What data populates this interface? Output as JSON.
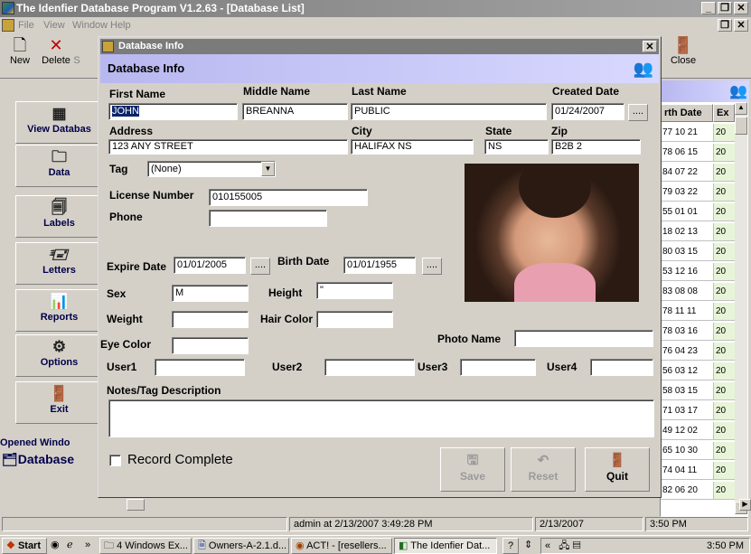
{
  "app": {
    "title": "The Idenfier Database Program V1.2.63 - [Database List]",
    "menu": [
      "File",
      "View",
      "Window",
      "Help"
    ],
    "toolbar": {
      "new": "New",
      "delete": "Delete",
      "s_label": "S",
      "close": "Close"
    },
    "sidebar": [
      {
        "label": "View Databas",
        "icon": "grid-icon"
      },
      {
        "label": "Data",
        "icon": "folder-icon"
      },
      {
        "label": "Labels",
        "icon": "labels-icon"
      },
      {
        "label": "Letters",
        "icon": "letters-icon"
      },
      {
        "label": "Reports",
        "icon": "reports-icon"
      },
      {
        "label": "Options",
        "icon": "options-icon"
      },
      {
        "label": "Exit",
        "icon": "exit-icon"
      }
    ],
    "opened_window_label": "Opened Windo",
    "opened_item": "Database",
    "grid": {
      "headers": [
        "rth Date",
        "Ex"
      ],
      "rows": [
        [
          "77 10 21",
          "20"
        ],
        [
          "78 06 15",
          "20"
        ],
        [
          "84 07 22",
          "20"
        ],
        [
          "79 03 22",
          "20"
        ],
        [
          "55 01 01",
          "20"
        ],
        [
          "18 02 13",
          "20"
        ],
        [
          "80 03 15",
          "20"
        ],
        [
          "53 12 16",
          "20"
        ],
        [
          "83 08 08",
          "20"
        ],
        [
          "78 11 11",
          "20"
        ],
        [
          "78 03 16",
          "20"
        ],
        [
          "76 04 23",
          "20"
        ],
        [
          "56 03 12",
          "20"
        ],
        [
          "58 03 15",
          "20"
        ],
        [
          "71 03 17",
          "20"
        ],
        [
          "49 12 02",
          "20"
        ],
        [
          "65 10 30",
          "20"
        ],
        [
          "74 04 11",
          "20"
        ],
        [
          "82 06 20",
          "20"
        ]
      ]
    },
    "status": {
      "user": "admin at 2/13/2007 3:49:28 PM",
      "date": "2/13/2007",
      "time": "3:50 PM"
    }
  },
  "dialog": {
    "title": "Database Info",
    "header": "Database Info",
    "labels": {
      "first_name": "First Name",
      "middle_name": "Middle Name",
      "last_name": "Last Name",
      "created_date": "Created Date",
      "address": "Address",
      "city": "City",
      "state": "State",
      "zip": "Zip",
      "tag": "Tag",
      "license_number": "License Number",
      "phone": "Phone",
      "expire_date": "Expire Date",
      "birth_date": "Birth Date",
      "sex": "Sex",
      "height": "Height",
      "weight": "Weight",
      "hair_color": "Hair Color",
      "eye_color": "Eye Color",
      "photo_name": "Photo Name",
      "user1": "User1",
      "user2": "User2",
      "user3": "User3",
      "user4": "User4",
      "notes": "Notes/Tag Description",
      "record_complete": "Record Complete"
    },
    "values": {
      "first_name": "JOHN",
      "middle_name": "BREANNA",
      "last_name": "PUBLIC",
      "created_date": "01/24/2007",
      "address": "123 ANY STREET",
      "city": "HALIFAX NS",
      "state": "NS",
      "zip": "B2B 2",
      "tag": "(None)",
      "license_number": "010155005",
      "phone": "",
      "expire_date": "01/01/2005",
      "birth_date": "01/01/1955",
      "sex": "M",
      "height": "\"",
      "weight": "",
      "hair_color": "",
      "eye_color": "",
      "photo_name": "",
      "user1": "",
      "user2": "",
      "user3": "",
      "user4": "",
      "notes": ""
    },
    "dots": "....",
    "buttons": {
      "save": "Save",
      "reset": "Reset",
      "quit": "Quit"
    }
  },
  "taskbar": {
    "start": "Start",
    "items": [
      "4 Windows Ex...",
      "Owners-A-2.1.d...",
      "ACT! - [resellers...",
      "The Idenfier Dat..."
    ],
    "clock": "3:50 PM",
    "chevron": "»",
    "tray_chevron": "«"
  }
}
